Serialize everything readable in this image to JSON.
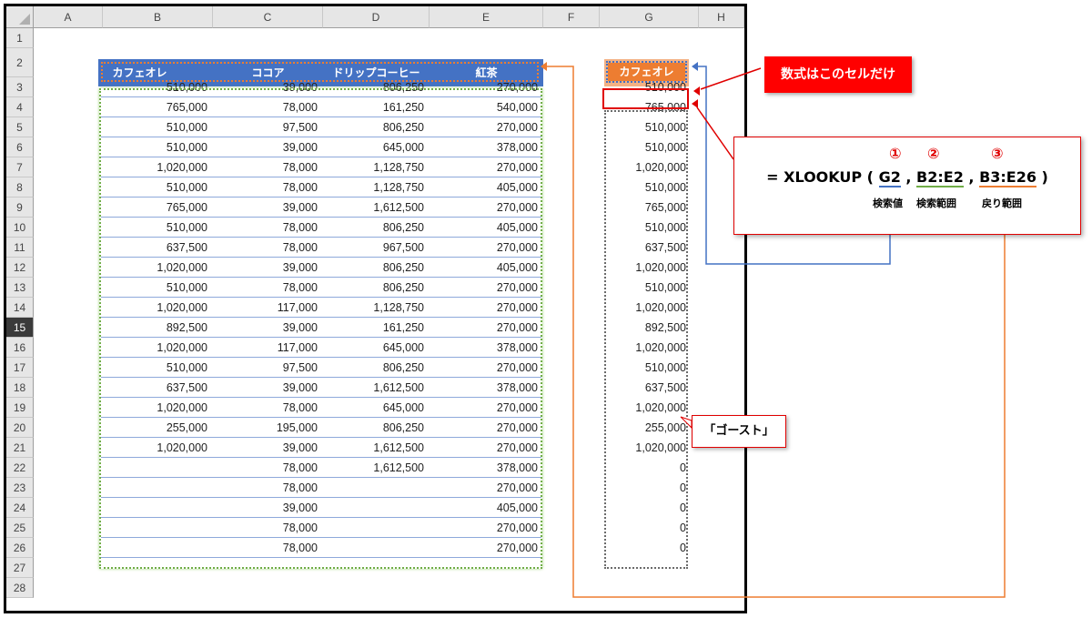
{
  "columns": [
    "A",
    "B",
    "C",
    "D",
    "E",
    "F",
    "G",
    "H"
  ],
  "rows": [
    "1",
    "2",
    "3",
    "4",
    "5",
    "6",
    "7",
    "8",
    "9",
    "10",
    "11",
    "12",
    "13",
    "14",
    "15",
    "16",
    "17",
    "18",
    "19",
    "20",
    "21",
    "22",
    "23",
    "24",
    "25",
    "26",
    "27",
    "28"
  ],
  "selected_row": "15",
  "table": {
    "headers": [
      "カフェオレ",
      "ココア",
      "ドリップコーヒー",
      "紅茶"
    ],
    "data": [
      [
        "510,000",
        "39,000",
        "806,250",
        "270,000"
      ],
      [
        "765,000",
        "78,000",
        "161,250",
        "540,000"
      ],
      [
        "510,000",
        "97,500",
        "806,250",
        "270,000"
      ],
      [
        "510,000",
        "39,000",
        "645,000",
        "378,000"
      ],
      [
        "1,020,000",
        "78,000",
        "1,128,750",
        "270,000"
      ],
      [
        "510,000",
        "78,000",
        "1,128,750",
        "405,000"
      ],
      [
        "765,000",
        "39,000",
        "1,612,500",
        "270,000"
      ],
      [
        "510,000",
        "78,000",
        "806,250",
        "405,000"
      ],
      [
        "637,500",
        "78,000",
        "967,500",
        "270,000"
      ],
      [
        "1,020,000",
        "39,000",
        "806,250",
        "405,000"
      ],
      [
        "510,000",
        "78,000",
        "806,250",
        "270,000"
      ],
      [
        "1,020,000",
        "117,000",
        "1,128,750",
        "270,000"
      ],
      [
        "892,500",
        "39,000",
        "161,250",
        "270,000"
      ],
      [
        "1,020,000",
        "117,000",
        "645,000",
        "378,000"
      ],
      [
        "510,000",
        "97,500",
        "806,250",
        "270,000"
      ],
      [
        "637,500",
        "39,000",
        "1,612,500",
        "378,000"
      ],
      [
        "1,020,000",
        "78,000",
        "645,000",
        "270,000"
      ],
      [
        "255,000",
        "195,000",
        "806,250",
        "270,000"
      ],
      [
        "1,020,000",
        "39,000",
        "1,612,500",
        "270,000"
      ],
      [
        "",
        "78,000",
        "1,612,500",
        "378,000"
      ],
      [
        "",
        "78,000",
        "",
        "270,000"
      ],
      [
        "",
        "39,000",
        "",
        "405,000"
      ],
      [
        "",
        "78,000",
        "",
        "270,000"
      ],
      [
        "",
        "78,000",
        "",
        "270,000"
      ]
    ]
  },
  "lookup": {
    "header": "カフェオレ",
    "values": [
      "510,000",
      "765,000",
      "510,000",
      "510,000",
      "1,020,000",
      "510,000",
      "765,000",
      "510,000",
      "637,500",
      "1,020,000",
      "510,000",
      "1,020,000",
      "892,500",
      "1,020,000",
      "510,000",
      "637,500",
      "1,020,000",
      "255,000",
      "1,020,000",
      "0",
      "0",
      "0",
      "0",
      "0"
    ]
  },
  "callouts": {
    "formula_only": "数式はこのセルだけ",
    "formula": {
      "prefix": "= XLOOKUP (",
      "arg1": "G2",
      "arg2": "B2:E2",
      "arg3": "B3:E26",
      "sep": ",",
      "suffix": ")",
      "num1": "①",
      "num2": "②",
      "num3": "③",
      "label1": "検索値",
      "label2": "検索範囲",
      "label3": "戻り範囲"
    },
    "ghost": "「ゴースト」"
  },
  "colors": {
    "header_blue": "#4472c4",
    "accent_orange": "#ed7d31",
    "green_dash": "#70ad47",
    "red": "#e00000",
    "callout_red_fill": "#ff0000"
  }
}
